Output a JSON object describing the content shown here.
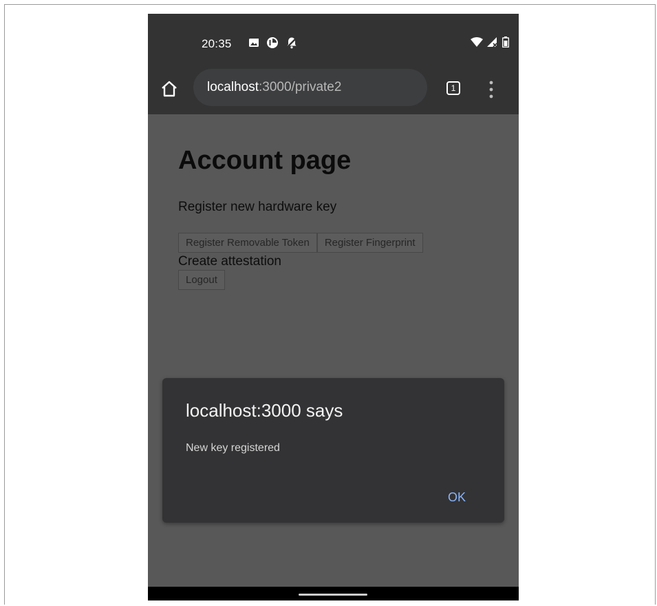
{
  "status_bar": {
    "time": "20:35",
    "left_icons": [
      "image-icon",
      "clock-pie-icon",
      "bell-off-icon"
    ],
    "right_icons": [
      "wifi-icon",
      "signal-icon",
      "battery-icon"
    ]
  },
  "browser": {
    "url_host": "localhost",
    "url_path": ":3000/private2",
    "tab_count": "1"
  },
  "page": {
    "title": "Account page",
    "subtitle": "Register new hardware key",
    "buttons": {
      "register_removable": "Register Removable Token",
      "register_fingerprint": "Register Fingerprint",
      "logout": "Logout"
    },
    "create_attestation": "Create attestation"
  },
  "dialog": {
    "title": "localhost:3000 says",
    "message": "New key registered",
    "ok_label": "OK"
  },
  "colors": {
    "scrim": "#585858",
    "chrome": "#333333",
    "accent": "#8ab4f8"
  }
}
